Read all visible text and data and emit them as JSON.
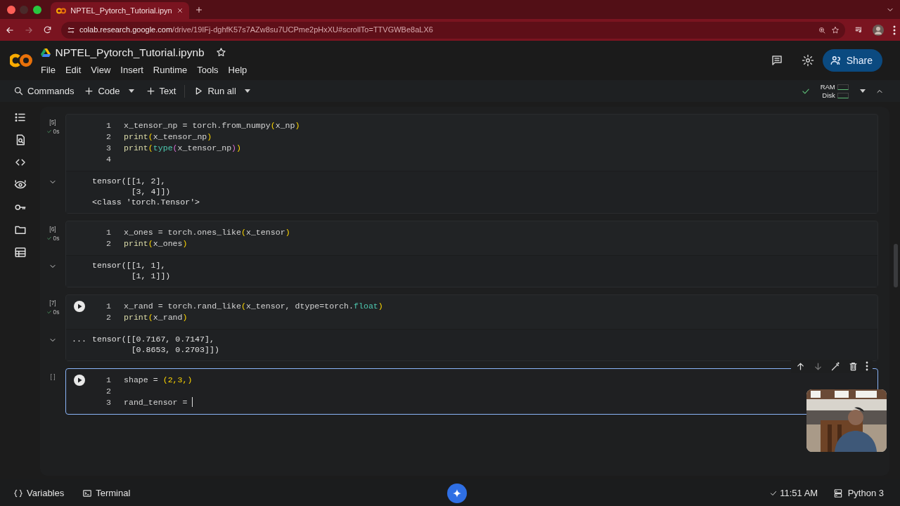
{
  "browser": {
    "tab_title": "NPTEL_Pytorch_Tutorial.ipyn",
    "url_host": "colab.research.google.com",
    "url_path": "/drive/19IFj-dghfK57s7AZw8su7UCPme2pHxXU#scrollTo=TTVGWBe8aLX6"
  },
  "app": {
    "title": "NPTEL_Pytorch_Tutorial.ipynb",
    "menu": [
      "File",
      "Edit",
      "View",
      "Insert",
      "Runtime",
      "Tools",
      "Help"
    ],
    "toolbar": [
      "Commands",
      "Code",
      "Text",
      "Run all"
    ],
    "share": "Share",
    "resources": [
      "RAM",
      "Disk"
    ],
    "connected": true
  },
  "cells": [
    {
      "exec": "[5]",
      "time": "0s",
      "done": true,
      "run_shown": false,
      "selected": false,
      "lines": [
        {
          "number": "1",
          "tokens": [
            {
              "text": "x_tensor_np = torch.from_numpy",
              "kind": "plain"
            },
            {
              "text": "(",
              "kind": "paren"
            },
            {
              "text": "x_np",
              "kind": "plain"
            },
            {
              "text": ")",
              "kind": "paren"
            }
          ]
        },
        {
          "number": "2",
          "tokens": [
            {
              "text": "print",
              "kind": "func"
            },
            {
              "text": "(",
              "kind": "paren"
            },
            {
              "text": "x_tensor_np",
              "kind": "plain"
            },
            {
              "text": ")",
              "kind": "paren"
            }
          ]
        },
        {
          "number": "3",
          "tokens": [
            {
              "text": "print",
              "kind": "func"
            },
            {
              "text": "(",
              "kind": "paren"
            },
            {
              "text": "type",
              "kind": "builtin"
            },
            {
              "text": "(",
              "kind": "paren2"
            },
            {
              "text": "x_tensor_np",
              "kind": "plain"
            },
            {
              "text": ")",
              "kind": "paren2"
            },
            {
              "text": ")",
              "kind": "paren"
            }
          ]
        },
        {
          "number": "4"
        }
      ],
      "output": {
        "busy": false,
        "lines": [
          "tensor([[1, 2],",
          "        [3, 4]])",
          "<class 'torch.Tensor'>"
        ]
      }
    },
    {
      "exec": "[6]",
      "time": "0s",
      "done": true,
      "run_shown": false,
      "selected": false,
      "lines": [
        {
          "number": "1",
          "tokens": [
            {
              "text": "x_ones = torch.ones_like",
              "kind": "plain"
            },
            {
              "text": "(",
              "kind": "paren"
            },
            {
              "text": "x_tensor",
              "kind": "plain"
            },
            {
              "text": ")",
              "kind": "paren"
            }
          ]
        },
        {
          "number": "2",
          "tokens": [
            {
              "text": "print",
              "kind": "func"
            },
            {
              "text": "(",
              "kind": "paren"
            },
            {
              "text": "x_ones",
              "kind": "plain"
            },
            {
              "text": ")",
              "kind": "paren"
            }
          ]
        }
      ],
      "output": {
        "busy": false,
        "lines": [
          "tensor([[1, 1],",
          "        [1, 1]])"
        ]
      }
    },
    {
      "exec": "[7]",
      "time": "0s",
      "done": true,
      "run_shown": true,
      "selected": false,
      "lines": [
        {
          "number": "1",
          "tokens": [
            {
              "text": "x_rand = torch.rand_like",
              "kind": "plain"
            },
            {
              "text": "(",
              "kind": "paren"
            },
            {
              "text": "x_tensor, dtype=torch.",
              "kind": "plain"
            },
            {
              "text": "float",
              "kind": "builtin"
            },
            {
              "text": ")",
              "kind": "paren"
            }
          ]
        },
        {
          "number": "2",
          "tokens": [
            {
              "text": "print",
              "kind": "func"
            },
            {
              "text": "(",
              "kind": "paren"
            },
            {
              "text": "x_rand",
              "kind": "plain"
            },
            {
              "text": ")",
              "kind": "paren"
            }
          ]
        }
      ],
      "output": {
        "busy": true,
        "busy_mark": "...",
        "lines": [
          "tensor([[0.7167, 0.7147],",
          "        [0.8653, 0.2703]])"
        ]
      }
    },
    {
      "exec": "[ ]",
      "done": false,
      "run_shown": true,
      "selected": true,
      "lines": [
        {
          "number": "1",
          "tokens": [
            {
              "text": "shape = ",
              "kind": "plain"
            },
            {
              "text": "(2,3,)",
              "kind": "paren"
            }
          ]
        },
        {
          "number": "2"
        },
        {
          "number": "3",
          "tokens": [
            {
              "text": "rand_tensor = ",
              "kind": "plain"
            }
          ],
          "cursor": true
        }
      ]
    }
  ],
  "status_bar": {
    "left": [
      "Variables",
      "Terminal"
    ],
    "time": "11:51 AM",
    "runtime": "Python 3"
  }
}
